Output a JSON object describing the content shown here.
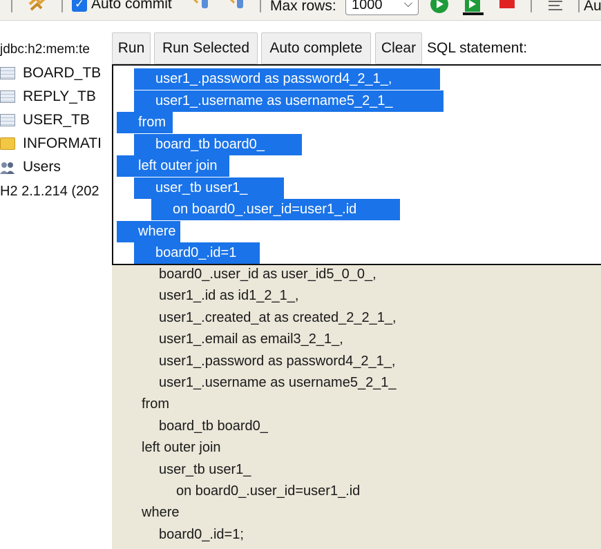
{
  "toolbar": {
    "auto_commit_label": "Auto commit",
    "auto_commit_checked": true,
    "max_rows_label": "Max rows:",
    "max_rows_value": "1000",
    "truncated_label": "Au",
    "icons": [
      "refresh-icon",
      "rollback-icon",
      "commit-icon",
      "run-icon",
      "run-script-icon",
      "stop-icon",
      "history-icon"
    ]
  },
  "tree": {
    "connection": "jdbc:h2:mem:te",
    "items": [
      {
        "label": "BOARD_TB",
        "icon": "table-icon"
      },
      {
        "label": "REPLY_TB",
        "icon": "table-icon"
      },
      {
        "label": "USER_TB",
        "icon": "table-icon"
      },
      {
        "label": "INFORMATI",
        "icon": "folder-icon"
      },
      {
        "label": "Users",
        "icon": "users-icon"
      }
    ],
    "version": "H2 2.1.214 (202"
  },
  "buttons": {
    "run": "Run",
    "run_selected": "Run Selected",
    "auto_complete": "Auto complete",
    "clear": "Clear"
  },
  "sql_label": "SQL statement:",
  "popup_lines": [
    "user1_.password as password4_2_1_,",
    "user1_.username as username5_2_1_",
    "from",
    "board_tb board0_",
    "left outer join",
    "user_tb user1_",
    "on board0_.user_id=user1_.id",
    "where",
    "board0_.id=1"
  ],
  "editor_lines": [
    "board0_.user_id as user_id5_0_0_,",
    "user1_.id as id1_2_1_,",
    "user1_.created_at as created_2_2_1_,",
    "user1_.email as email3_2_1_,",
    "user1_.password as password4_2_1_,",
    "user1_.username as username5_2_1_",
    "from",
    "board_tb board0_",
    "left outer join",
    "user_tb user1_",
    "on board0_.user_id=user1_.id",
    "where",
    "board0_.id=1;"
  ],
  "colors": {
    "selection": "#1a73e8",
    "editor_bg": "#ebe7d9",
    "toolbar_bg": "#f3f1ec"
  }
}
